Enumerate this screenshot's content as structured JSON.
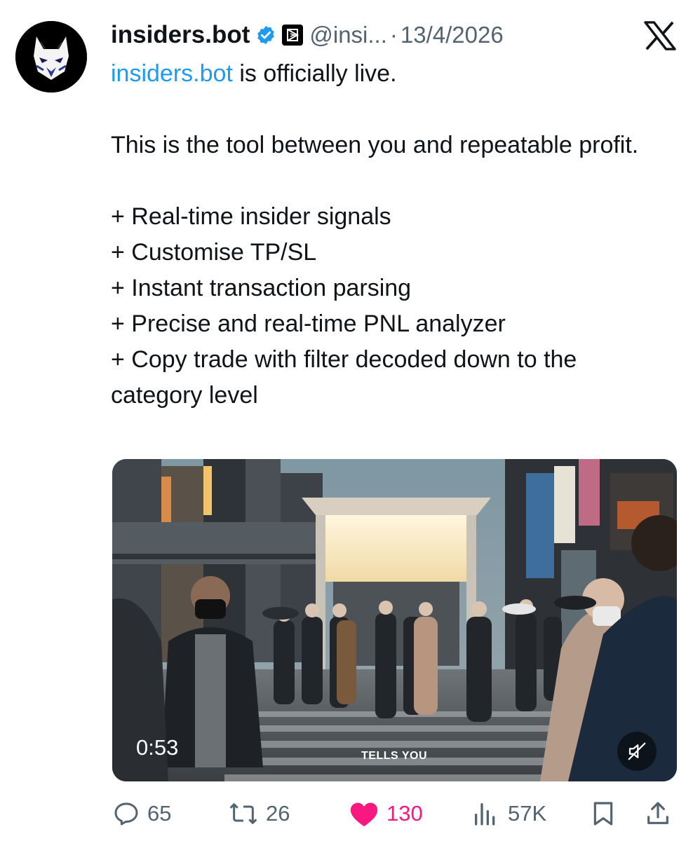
{
  "tweet": {
    "author": {
      "display_name": "insiders.bot",
      "handle": "@insi...",
      "verified": true,
      "avatar_icon": "fox-mask-icon"
    },
    "date": "13/4/2026",
    "separator": "·",
    "body": {
      "mention": "insiders.bot",
      "line1_rest": " is officially live.",
      "para2": "This is the tool between you and repeatable profit.",
      "bullets": [
        "+ Real-time insider signals",
        "+ Customise TP/SL",
        "+ Instant transaction parsing",
        "+ Precise and real-time PNL analyzer",
        "+ Copy trade with filter decoded down to the category level"
      ]
    },
    "media": {
      "type": "video",
      "duration": "0:53",
      "caption": "TELLS YOU",
      "muted": true
    },
    "stats": {
      "replies": "65",
      "reposts": "26",
      "likes": "130",
      "views": "57K",
      "liked": true
    }
  },
  "colors": {
    "link": "#1d9bf0",
    "like": "#f91880",
    "secondary_text": "#536471",
    "verified": "#1d9bf0"
  },
  "icons": [
    "fox-mask-icon",
    "verified-badge-icon",
    "affiliate-badge-icon",
    "x-logo-icon",
    "mute-icon",
    "reply-icon",
    "repost-icon",
    "like-icon",
    "views-icon",
    "bookmark-icon",
    "share-icon"
  ]
}
